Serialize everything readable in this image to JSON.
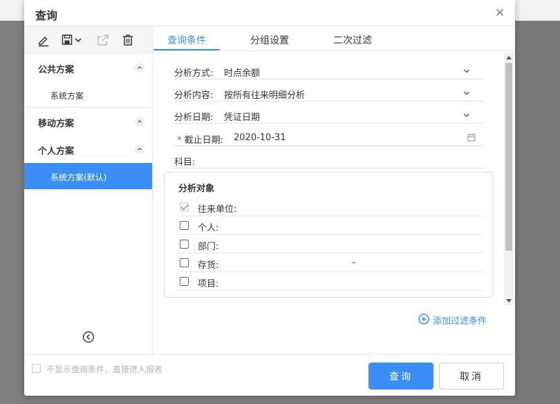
{
  "dialog": {
    "title": "查询"
  },
  "sidebar": {
    "sections": [
      {
        "title": "公共方案",
        "items": [
          "系统方案"
        ]
      },
      {
        "title": "移动方案",
        "items": []
      },
      {
        "title": "个人方案",
        "items": [
          "系统方案(默认)"
        ]
      }
    ],
    "active_item": "系统方案(默认)"
  },
  "tabs": [
    "查询条件",
    "分组设置",
    "二次过滤"
  ],
  "active_tab": "查询条件",
  "form": {
    "analysis_method": {
      "label": "分析方式:",
      "value": "时点余额"
    },
    "analysis_content": {
      "label": "分析内容:",
      "value": "按所有往来明细分析"
    },
    "analysis_date": {
      "label": "分析日期:",
      "value": "凭证日期"
    },
    "cutoff_date": {
      "required_mark": "*",
      "label": "截止日期:",
      "value": "2020-10-31"
    },
    "subject": {
      "label": "科目:",
      "value": ""
    }
  },
  "analysis_objects": {
    "title": "分析对象",
    "rows": [
      {
        "label": "往来单位:",
        "checked": true,
        "value": ""
      },
      {
        "label": "个人:",
        "checked": false,
        "value": ""
      },
      {
        "label": "部门:",
        "checked": false,
        "value": ""
      },
      {
        "label": "存货:",
        "checked": false,
        "value": "-"
      },
      {
        "label": "项目:",
        "checked": false,
        "value": ""
      }
    ]
  },
  "add_filter_label": "添加过滤条件",
  "footer": {
    "skip_label": "不显示查询条件，直接进入报表",
    "query_button": "查询",
    "cancel_button": "取消"
  },
  "colors": {
    "accent": "#3a8ef6",
    "required": "#e4393c"
  }
}
